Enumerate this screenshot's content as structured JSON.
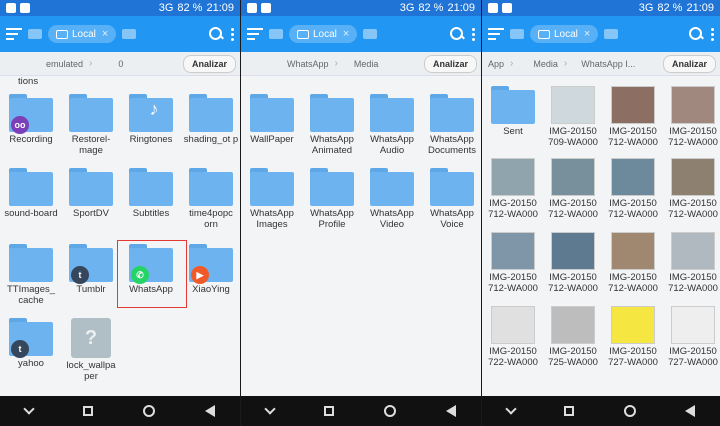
{
  "statusbar": {
    "signal": "3G",
    "battery": "82 %",
    "time": "21:09"
  },
  "appbar": {
    "tab_label": "Local",
    "tab_close": "×"
  },
  "panels": [
    {
      "breadcrumbs": [
        "emulated",
        "0"
      ],
      "analyze_label": "Analizar",
      "partial_top_label": "tions",
      "items": [
        {
          "label": "Recording",
          "badge": "oo",
          "badge_color": "#7b3fb8"
        },
        {
          "label": "Restorel-mage"
        },
        {
          "label": "Ringtones",
          "badge": "♪",
          "badge_color": "transparent"
        },
        {
          "label": "shading_ot p"
        },
        {
          "label": "sound-board"
        },
        {
          "label": "SportDV"
        },
        {
          "label": "Subtitles"
        },
        {
          "label": "time4popc orn"
        },
        {
          "label": "TTImages_ cache"
        },
        {
          "label": "Tumblr",
          "badge": "t",
          "badge_color": "#36465d"
        },
        {
          "label": "WhatsApp",
          "badge": "✆",
          "badge_color": "#25d366",
          "highlighted": true
        },
        {
          "label": "XiaoYing",
          "badge": "▶",
          "badge_color": "#f05a28"
        },
        {
          "label": "yahoo",
          "badge": "t",
          "badge_color": "#36465d"
        },
        {
          "label": "lock_wallpa per",
          "badge": "?",
          "badge_color": "transparent",
          "doc": true
        }
      ]
    },
    {
      "breadcrumbs": [
        "WhatsApp",
        "Media"
      ],
      "analyze_label": "Analizar",
      "items": [
        {
          "label": "WallPaper"
        },
        {
          "label": "WhatsApp Animated"
        },
        {
          "label": "WhatsApp Audio"
        },
        {
          "label": "WhatsApp Documents"
        },
        {
          "label": "WhatsApp Images"
        },
        {
          "label": "WhatsApp Profile"
        },
        {
          "label": "WhatsApp Video"
        },
        {
          "label": "WhatsApp Voice"
        }
      ]
    },
    {
      "breadcrumbs": [
        "App",
        "Media",
        "WhatsApp I..."
      ],
      "analyze_label": "Analizar",
      "items": [
        {
          "label": "Sent",
          "folder": true
        },
        {
          "label": "IMG-20150 709-WA000",
          "color": "#cfd8dc"
        },
        {
          "label": "IMG-20150 712-WA000",
          "color": "#8d6e63"
        },
        {
          "label": "IMG-20150 712-WA000",
          "color": "#a1887f"
        },
        {
          "label": "IMG-20150 712-WA000",
          "color": "#90a4ae"
        },
        {
          "label": "IMG-20150 712-WA000",
          "color": "#78909c"
        },
        {
          "label": "IMG-20150 712-WA000",
          "color": "#6d8a9c"
        },
        {
          "label": "IMG-20150 712-WA000",
          "color": "#8d8070"
        },
        {
          "label": "IMG-20150 712-WA000",
          "color": "#7f95a8"
        },
        {
          "label": "IMG-20150 712-WA000",
          "color": "#5d7a90"
        },
        {
          "label": "IMG-20150 712-WA000",
          "color": "#a08870"
        },
        {
          "label": "IMG-20150 712-WA000",
          "color": "#b0b8c0"
        },
        {
          "label": "IMG-20150 722-WA000",
          "color": "#e0e0e0"
        },
        {
          "label": "IMG-20150 725-WA000",
          "color": "#bdbdbd"
        },
        {
          "label": "IMG-20150 727-WA000",
          "color": "#f5e642"
        },
        {
          "label": "IMG-20150 727-WA000",
          "color": "#eeeeee"
        }
      ]
    }
  ]
}
